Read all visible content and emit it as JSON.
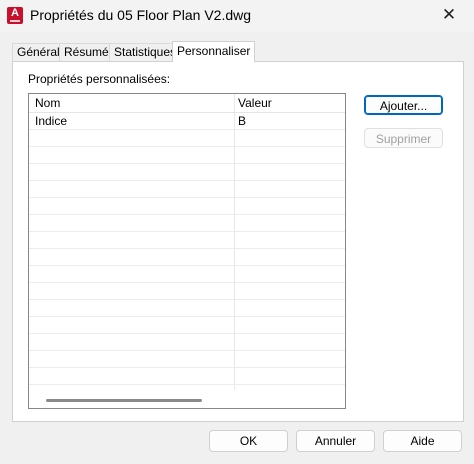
{
  "window": {
    "title": "Propriétés du 05 Floor Plan V2.dwg",
    "app_icon_letter": "A",
    "close_symbol": "✕"
  },
  "tabs": [
    {
      "label": "Général",
      "active": false
    },
    {
      "label": "Résumé",
      "active": false
    },
    {
      "label": "Statistiques",
      "active": false
    },
    {
      "label": "Personnaliser",
      "active": true
    }
  ],
  "custom": {
    "label": "Propriétés personnalisées:",
    "columns": [
      "Nom",
      "Valeur"
    ],
    "rows": [
      {
        "name": "Indice",
        "value": "B"
      }
    ],
    "buttons": {
      "add": "Ajouter...",
      "delete": "Supprimer"
    }
  },
  "footer": {
    "ok": "OK",
    "cancel": "Annuler",
    "help": "Aide"
  },
  "colors": {
    "accent": "#0067c0",
    "app_icon": "#c8102e"
  }
}
